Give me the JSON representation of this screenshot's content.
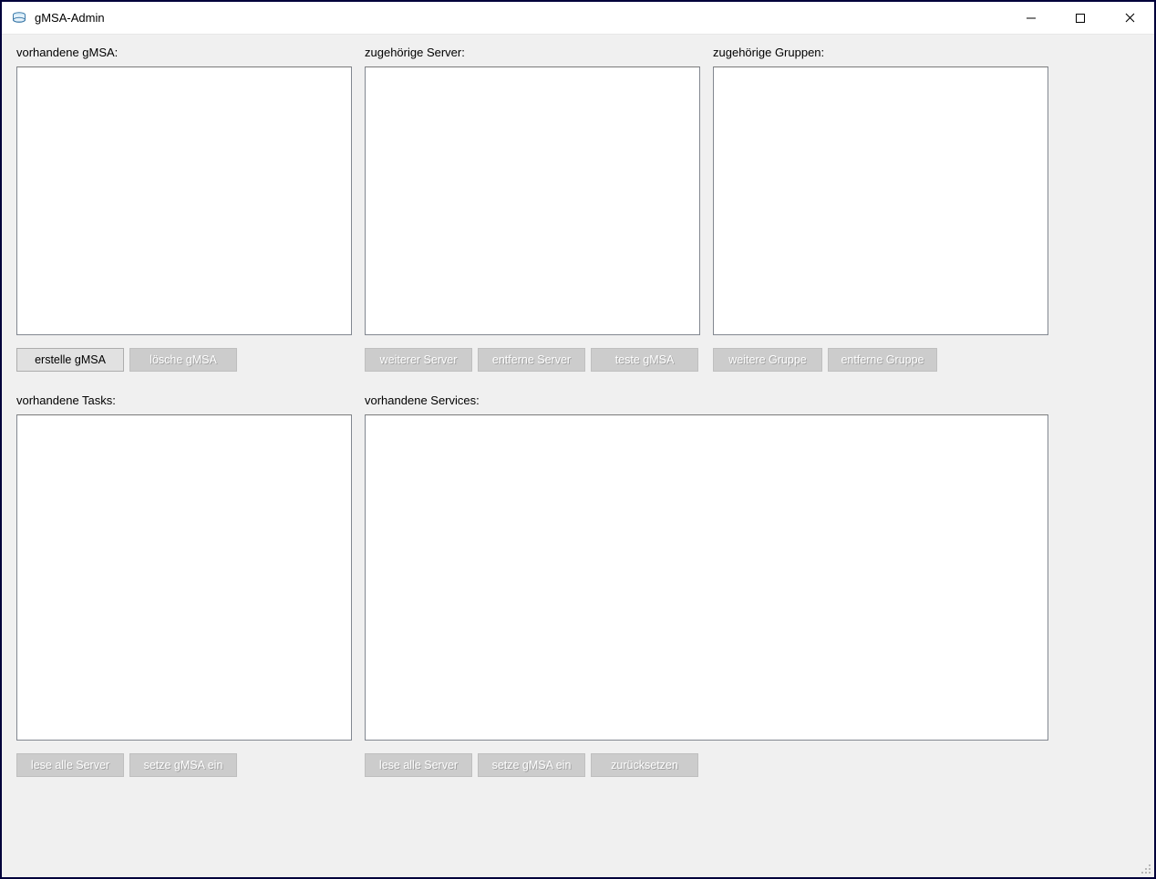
{
  "window": {
    "title": "gMSA-Admin"
  },
  "labels": {
    "gmsa": "vorhandene gMSA:",
    "servers": "zugehörige Server:",
    "groups": "zugehörige Gruppen:",
    "tasks": "vorhandene Tasks:",
    "services": "vorhandene Services:"
  },
  "buttons": {
    "create_gmsa": "erstelle gMSA",
    "delete_gmsa": "lösche gMSA",
    "add_server": "weiterer Server",
    "remove_server": "entferne Server",
    "test_gmsa": "teste gMSA",
    "add_group": "weitere Gruppe",
    "remove_group": "entferne Gruppe",
    "read_servers_t": "lese alle Server",
    "set_gmsa_t": "setze gMSA ein",
    "read_servers_s": "lese alle Server",
    "set_gmsa_s": "setze gMSA ein",
    "reset": "zurücksetzen"
  },
  "lists": {
    "gmsa": [],
    "servers": [],
    "groups": [],
    "tasks": [],
    "services": []
  }
}
